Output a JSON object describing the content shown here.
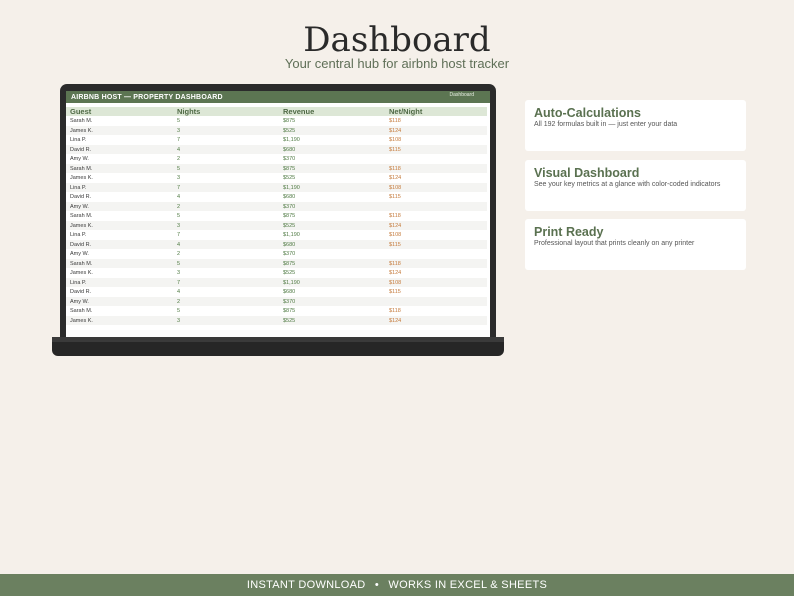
{
  "header": {
    "title": "Dashboard",
    "subtitle": "Your central hub for airbnb host tracker"
  },
  "sheet": {
    "title": "AIRBNB HOST — PROPERTY DASHBOARD",
    "tab_label": "Dashboard",
    "columns": [
      "Guest",
      "Nights",
      "Revenue",
      "Net/Night"
    ],
    "rows": [
      [
        "Sarah M.",
        "5",
        "$875",
        "$118"
      ],
      [
        "James K.",
        "3",
        "$525",
        "$124"
      ],
      [
        "Lina P.",
        "7",
        "$1,190",
        "$108"
      ],
      [
        "David R.",
        "4",
        "$680",
        "$115"
      ],
      [
        "Amy W.",
        "2",
        "$370",
        ""
      ],
      [
        "Sarah M.",
        "5",
        "$875",
        "$118"
      ],
      [
        "James K.",
        "3",
        "$525",
        "$124"
      ],
      [
        "Lina P.",
        "7",
        "$1,190",
        "$108"
      ],
      [
        "David R.",
        "4",
        "$680",
        "$115"
      ],
      [
        "Amy W.",
        "2",
        "$370",
        ""
      ],
      [
        "Sarah M.",
        "5",
        "$875",
        "$118"
      ],
      [
        "James K.",
        "3",
        "$525",
        "$124"
      ],
      [
        "Lina P.",
        "7",
        "$1,190",
        "$108"
      ],
      [
        "David R.",
        "4",
        "$680",
        "$115"
      ],
      [
        "Amy W.",
        "2",
        "$370",
        ""
      ],
      [
        "Sarah M.",
        "5",
        "$875",
        "$118"
      ],
      [
        "James K.",
        "3",
        "$525",
        "$124"
      ],
      [
        "Lina P.",
        "7",
        "$1,190",
        "$108"
      ],
      [
        "David R.",
        "4",
        "$680",
        "$115"
      ],
      [
        "Amy W.",
        "2",
        "$370",
        ""
      ],
      [
        "Sarah M.",
        "5",
        "$875",
        "$118"
      ],
      [
        "James K.",
        "3",
        "$525",
        "$124"
      ]
    ]
  },
  "features": [
    {
      "title": "Auto-Calculations",
      "desc": "All 192 formulas built in — just enter your data"
    },
    {
      "title": "Visual Dashboard",
      "desc": "See your key metrics at a glance with color-coded indicators"
    },
    {
      "title": "Print Ready",
      "desc": "Professional layout that prints cleanly on any printer"
    }
  ],
  "footer": {
    "left": "INSTANT DOWNLOAD",
    "separator": "•",
    "right": "WORKS IN EXCEL & SHEETS"
  },
  "colors": {
    "accent": "#5c7552",
    "background": "#f5f0ea",
    "positive": "#4f7a43",
    "net": "#c57b3c"
  }
}
